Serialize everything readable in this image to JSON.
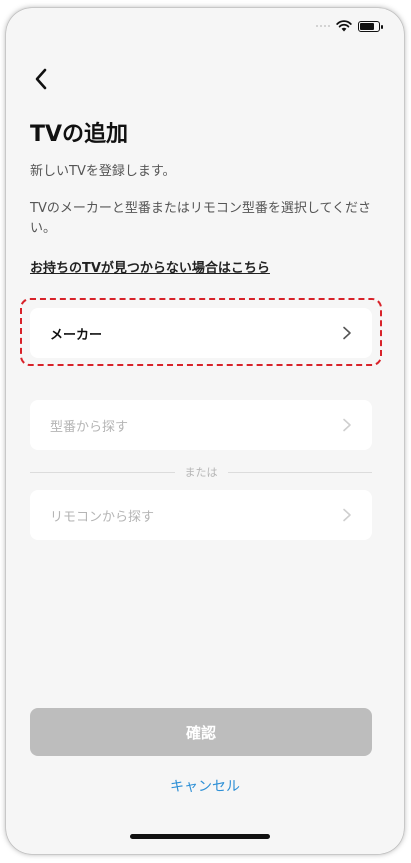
{
  "status_bar": {
    "signal_icon": "cellular-signal-icon",
    "wifi_icon": "wifi-icon",
    "battery_icon": "battery-icon",
    "battery_level": 0.8
  },
  "header": {
    "back_icon": "chevron-left-icon",
    "title": "TVの追加"
  },
  "intro": {
    "line1": "新しいTVを登録します。",
    "line2": "TVのメーカーと型番またはリモコン型番を選択してください。"
  },
  "help_link": "お持ちのTVが見つからない場合はこちら",
  "rows": {
    "maker": {
      "label": "メーカー",
      "icon": "chevron-right-icon"
    },
    "model": {
      "label": "型番から探す",
      "icon": "chevron-right-icon"
    },
    "remote": {
      "label": "リモコンから探す",
      "icon": "chevron-right-icon"
    }
  },
  "divider_text": "または",
  "confirm_label": "確認",
  "cancel_label": "キャンセル",
  "colors": {
    "highlight": "#d8232a",
    "link": "#2c8fd6",
    "disabled_button": "#bdbdbd",
    "background": "#f6f6f6"
  }
}
